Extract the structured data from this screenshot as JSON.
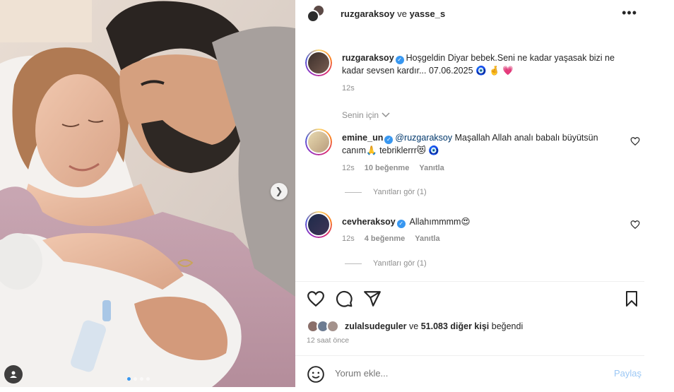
{
  "post": {
    "header": {
      "user1": "ruzgaraksoy",
      "joiner": " ve ",
      "user2": "yasse_s"
    },
    "caption": {
      "username": "ruzgaraksoy",
      "text": "Hoşgeldin Diyar bebek.Seni ne kadar yaşasak bizi ne kadar sevsen kardır... 07.06.2025 🧿 🤞 💗",
      "time": "12s"
    },
    "for_you_label": "Senin için"
  },
  "comments": [
    {
      "username": "emine_un",
      "mention": "@ruzgaraksoy",
      "text": " Maşallah Allah analı babalı büyütsün canım🙏 tebriklerrr😻 🧿",
      "time": "12s",
      "likes": "10 beğenme",
      "reply": "Yanıtla",
      "view_replies": "Yanıtları gör (1)"
    },
    {
      "username": "cevheraksoy",
      "text": " Allahımmmm😍",
      "time": "12s",
      "likes": "4 beğenme",
      "reply": "Yanıtla",
      "view_replies": "Yanıtları gör (1)"
    }
  ],
  "likes_summary": {
    "user": "zulalsudeguler",
    "joiner": " ve ",
    "others": "51.083 diğer kişi",
    "suffix": " beğendi"
  },
  "posted_ago": "12 saat önce",
  "comment_box": {
    "placeholder": "Yorum ekle...",
    "post_label": "Paylaş"
  },
  "icons": [
    "more-options-icon",
    "verified-badge-icon",
    "chevron-down-icon",
    "heart-icon",
    "comment-icon",
    "share-icon",
    "bookmark-icon",
    "emoji-icon",
    "next-arrow-icon",
    "user-tag-icon"
  ],
  "colors": {
    "accent": "#3897f0",
    "muted": "#8e8e8e",
    "text": "#262626",
    "post_disabled": "#9cc8f5"
  }
}
